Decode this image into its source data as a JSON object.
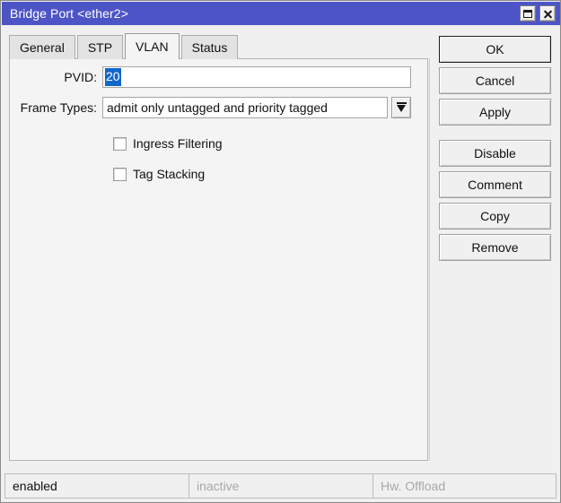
{
  "window": {
    "title": "Bridge Port <ether2>",
    "titlebar_color": "#4d55c6",
    "controls": [
      {
        "name": "restore-button",
        "glyph": "restore-icon"
      },
      {
        "name": "close-button",
        "glyph": "close-icon"
      }
    ]
  },
  "tabs": [
    {
      "label": "General",
      "active": false
    },
    {
      "label": "STP",
      "active": false
    },
    {
      "label": "VLAN",
      "active": true
    },
    {
      "label": "Status",
      "active": false
    }
  ],
  "form": {
    "pvid": {
      "label": "PVID:",
      "value": "20",
      "selected": true,
      "selection_color": "#1166cc"
    },
    "frame_types": {
      "label": "Frame Types:",
      "value": "admit only untagged and priority tagged",
      "arrow_icon": "chevron-down-icon"
    },
    "checkboxes": [
      {
        "label": "Ingress Filtering",
        "checked": false
      },
      {
        "label": "Tag Stacking",
        "checked": false
      }
    ]
  },
  "buttons": [
    {
      "label": "OK",
      "default": true
    },
    {
      "label": "Cancel",
      "default": false
    },
    {
      "label": "Apply",
      "default": false
    },
    {
      "label": "Disable",
      "default": false
    },
    {
      "label": "Comment",
      "default": false
    },
    {
      "label": "Copy",
      "default": false
    },
    {
      "label": "Remove",
      "default": false
    }
  ],
  "statusbar": {
    "enabled": "enabled",
    "inactive": "inactive",
    "hw_offload": "Hw. Offload"
  }
}
